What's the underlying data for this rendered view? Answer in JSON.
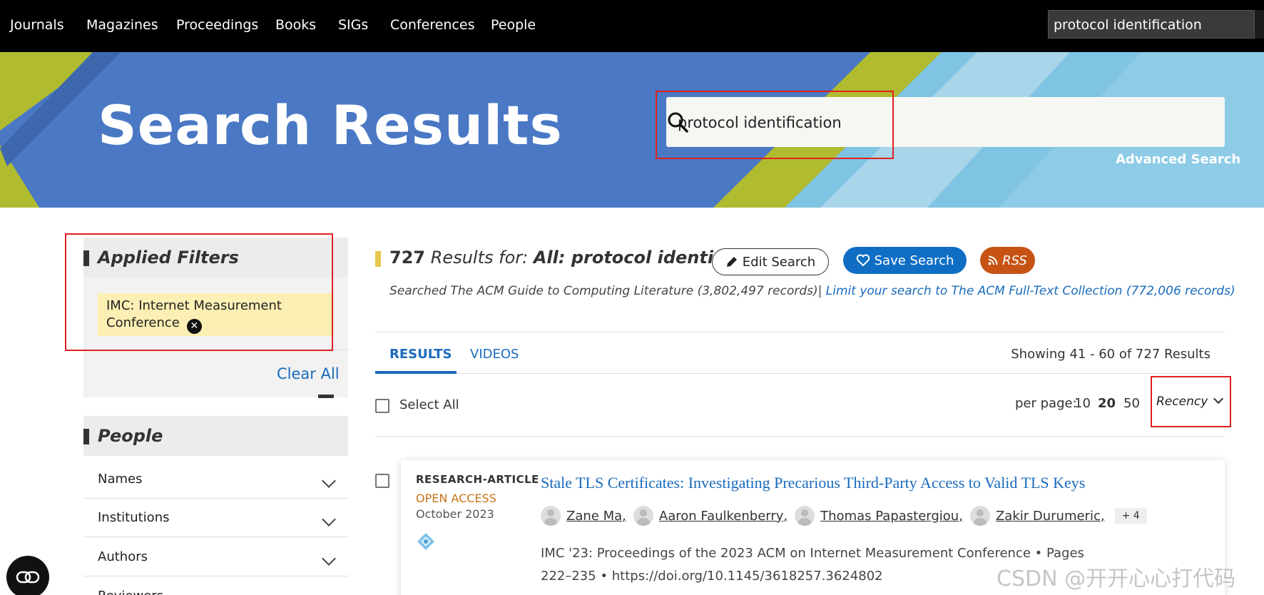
{
  "topnav": {
    "items": [
      "Journals",
      "Magazines",
      "Proceedings",
      "Books",
      "SIGs",
      "Conferences",
      "People"
    ],
    "quick_search_value": "protocol identification"
  },
  "banner": {
    "title": "Search Results",
    "search_value": "protocol identification",
    "advanced_search": "Advanced Search"
  },
  "sidebar": {
    "applied_filters_title": "Applied Filters",
    "filter_chip": "IMC: Internet Measurement Conference",
    "clear_all": "Clear All",
    "people_title": "People",
    "facets": [
      "Names",
      "Institutions",
      "Authors",
      "Reviewers"
    ]
  },
  "results_header": {
    "count": "727",
    "results_for": "Results for:",
    "query": "All: protocol identification",
    "edit_search": "Edit Search",
    "save_search": "Save Search",
    "rss": "RSS",
    "searched_text": "Searched The ACM Guide to Computing Literature (3,802,497 records)",
    "separator": "|",
    "limit_link": "Limit your search to The ACM Full-Text Collection (772,006 records)"
  },
  "tabs": {
    "results": "RESULTS",
    "videos": "VIDEOS",
    "showing": "Showing 41 - 60  of 727 Results"
  },
  "controls": {
    "select_all": "Select All",
    "per_page_label": "per page:",
    "per_page_options": [
      "10",
      "20",
      "50"
    ],
    "per_page_selected": "20",
    "sort": "Recency"
  },
  "result": {
    "type": "RESEARCH-ARTICLE",
    "access": "OPEN ACCESS",
    "date": "October 2023",
    "title": "Stale TLS Certificates: Investigating Precarious Third-Party Access to Valid TLS Keys",
    "authors": [
      "Zane Ma",
      "Aaron Faulkenberry",
      "Thomas Papastergiou",
      "Zakir Durumeric"
    ],
    "more_authors": "+ 4",
    "publication": "IMC '23: Proceedings of the 2023 ACM on Internet Measurement Conference • Pages 222–235 • https://doi.org/10.1145/3618257.3624802"
  },
  "watermark": "CSDN @开开心心打代码",
  "colors": {
    "nav_bg": "#000000",
    "banner_blue": "#4a78c4",
    "banner_olive": "#b1bb2f",
    "link_blue": "#1a6bbd",
    "save_blue": "#0f6ec4",
    "rss_orange": "#c65314",
    "open_access": "#c8731a",
    "filter_chip_bg": "#fcefb4",
    "highlight_red": "#e02020"
  }
}
